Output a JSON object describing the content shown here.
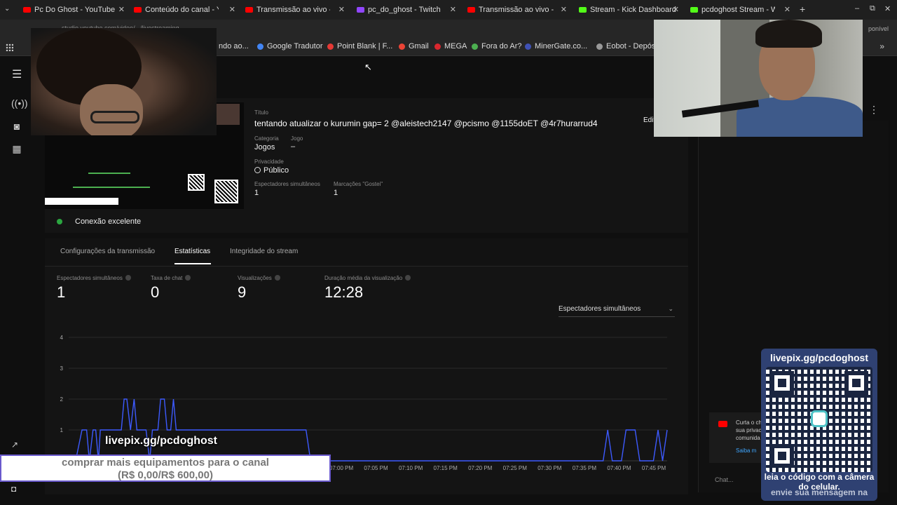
{
  "browser": {
    "tabs": [
      {
        "label": "Pc Do Ghost - YouTube",
        "icon": "youtube-icon",
        "color": "#ff0000"
      },
      {
        "label": "Conteúdo do canal - Yo",
        "icon": "youtube-studio-icon",
        "color": "#ff0000"
      },
      {
        "label": "Transmissão ao vivo - Yo",
        "icon": "youtube-icon",
        "color": "#ff0000"
      },
      {
        "label": "pc_do_ghost - Twitch",
        "icon": "twitch-icon",
        "color": "#9146ff"
      },
      {
        "label": "Transmissão ao vivo - Yo",
        "icon": "youtube-icon",
        "color": "#ff0000"
      },
      {
        "label": "Stream - Kick Dashboard",
        "icon": "kick-icon",
        "color": "#53fc18"
      },
      {
        "label": "pcdoghost Stream - Wa",
        "icon": "kick-icon",
        "color": "#53fc18"
      }
    ],
    "close_glyph": "✕",
    "new_tab_glyph": "+",
    "window_controls": [
      "–",
      "⧉",
      "✕"
    ],
    "address": "studio.youtube.com/video/.../livestreaming",
    "address_right": "ponível",
    "bookmarks": [
      {
        "label": "ndo ao...",
        "color": "#ff0000"
      },
      {
        "label": "Google Tradutor",
        "color": "#4285f4"
      },
      {
        "label": "Point Blank | F...",
        "color": "#e53935"
      },
      {
        "label": "Gmail",
        "color": "#ea4335"
      },
      {
        "label": "MEGA",
        "color": "#d9272e"
      },
      {
        "label": "Fora do Ar?",
        "color": "#4caf50"
      },
      {
        "label": "MinerGate.co...",
        "color": "#3f51b5"
      },
      {
        "label": "Eobot - Depósit",
        "color": "#999999"
      }
    ],
    "bookmarks_more": "»"
  },
  "studio": {
    "menu_glyph": "☰",
    "rail_icons": [
      "live-icon",
      "camera-icon",
      "calendar-icon"
    ],
    "stream": {
      "title_label": "Título",
      "title": "tentando atualizar o kurumin gap= 2 @aleistech2147 @pcismo @1155doET @4r7hurarrud4",
      "edit_label": "Edit",
      "category_label": "Categoria",
      "category": "Jogos",
      "game_label": "Jogo",
      "game": "–",
      "privacy_label": "Privacidade",
      "privacy": "Público",
      "concurrent_label": "Espectadores simultâneos",
      "concurrent": "1",
      "likes_label": "Marcações \"Gostei\"",
      "likes": "1",
      "connection": "Conexão excelente",
      "connection_color": "#2ba640"
    },
    "tabs": [
      {
        "label": "Configurações da transmissão",
        "active": false
      },
      {
        "label": "Estatísticas",
        "active": true
      },
      {
        "label": "Integridade do stream",
        "active": false
      }
    ],
    "stats": [
      {
        "label": "Espectadores simultâneos",
        "value": "1"
      },
      {
        "label": "Taxa de chat",
        "value": "0"
      },
      {
        "label": "Visualizações",
        "value": "9"
      },
      {
        "label": "Duração média da visualização",
        "value": "12:28"
      }
    ],
    "metric_select": "Espectadores simultâneos",
    "right_panel": {
      "notice_lines": [
        "Curta o ch",
        "sua privac",
        "comunida"
      ],
      "notice_link": "Saiba m",
      "chat_placeholder": "Chat..."
    }
  },
  "chart_data": {
    "type": "line",
    "y_ticks": [
      "4",
      "3",
      "2",
      "1"
    ],
    "ylim": [
      0,
      4
    ],
    "x_ticks": [
      "07:00 PM",
      "07:05 PM",
      "07:10 PM",
      "07:15 PM",
      "07:20 PM",
      "07:25 PM",
      "07:30 PM",
      "07:35 PM",
      "07:40 PM",
      "07:45 PM"
    ],
    "line_color": "#3d5afe",
    "series": [
      {
        "x": [
          0,
          0.3,
          1,
          1.5,
          1.8,
          2.2,
          2.5,
          2.8,
          3,
          3.4,
          3.8,
          4,
          5.2,
          5.3,
          5.6,
          5.9,
          6.3,
          6.7,
          7.0,
          7.3,
          7.6,
          8.0,
          8.4,
          8.7,
          9.0,
          9.3,
          9.6,
          10,
          10.3,
          10.7,
          11.0,
          11.3,
          11.6,
          11.9,
          12.2,
          12.6,
          13.0,
          13.3,
          13.6,
          14,
          16,
          18,
          20,
          22,
          24,
          25.5,
          26,
          26.5,
          27,
          27.5,
          28,
          29,
          30,
          30.5,
          31,
          31.3,
          31.6,
          32,
          33,
          34,
          35,
          36,
          37,
          38,
          39,
          40,
          41,
          42,
          43,
          44,
          45,
          46,
          47,
          48,
          49,
          50,
          51,
          52,
          53,
          54,
          55,
          56,
          57,
          58,
          58.5,
          59,
          59.5,
          60,
          60.5,
          61,
          61.5,
          62,
          62.5,
          63,
          63.5,
          64,
          64.5,
          65
        ],
        "y": [
          0,
          0,
          1,
          1,
          0,
          1,
          1,
          0,
          1,
          1,
          1,
          1,
          1,
          1,
          2,
          2,
          1,
          2,
          1,
          1,
          1,
          1,
          0,
          1,
          1,
          1,
          2,
          2,
          1,
          1,
          2,
          1,
          1,
          1,
          1,
          1,
          1,
          1,
          1,
          1,
          1,
          1,
          1,
          1,
          1,
          1,
          0,
          0,
          0,
          0,
          0,
          0,
          0,
          0,
          0,
          0,
          0,
          0,
          0,
          0,
          0,
          0,
          0,
          0,
          0,
          0,
          0,
          0,
          0,
          0,
          0,
          0,
          0,
          0,
          0,
          0,
          0,
          0,
          0,
          0,
          0,
          0,
          0,
          0,
          1,
          0,
          0,
          0,
          1,
          1,
          1,
          0,
          0,
          0,
          0,
          1,
          0,
          1
        ]
      }
    ]
  },
  "overlay": {
    "livepix_name": "livepix.gg/pcdoghost",
    "goal_line1": "comprar mais equipamentos para o canal",
    "goal_line2": "(R$ 0,00/R$ 600,00)",
    "qr_url": "livepix.gg/pcdoghost",
    "qr_caption1": "leia o código com a câmera do celular.",
    "qr_caption2": "envie sua mensagem na"
  }
}
